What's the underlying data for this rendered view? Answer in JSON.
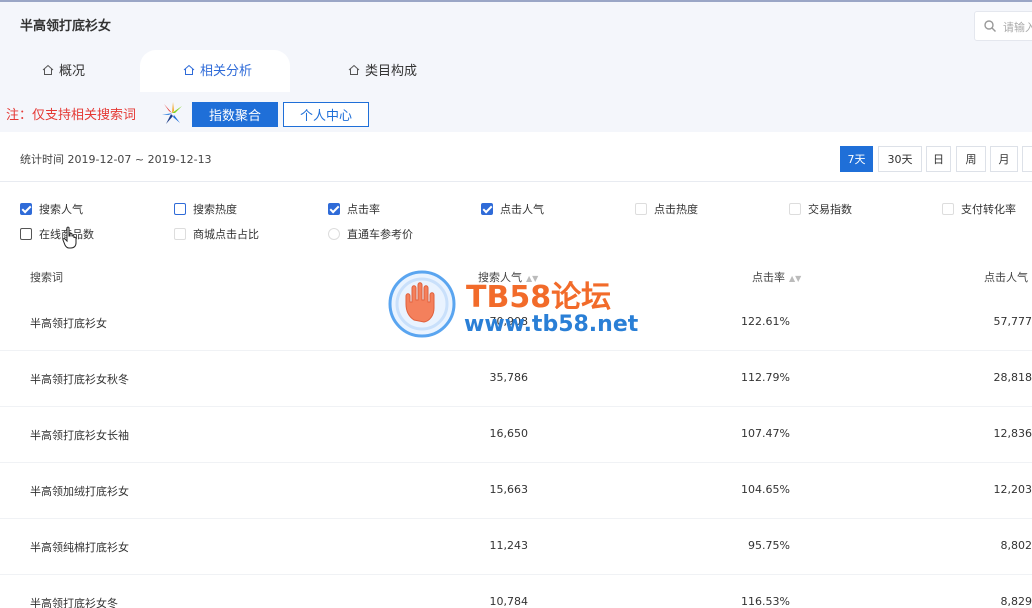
{
  "header": {
    "title": "半高领打底衫女",
    "search_placeholder": "请输入"
  },
  "tabs": [
    {
      "label": "概况",
      "active": false
    },
    {
      "label": "相关分析",
      "active": true
    },
    {
      "label": "类目构成",
      "active": false
    }
  ],
  "notice": "注：仅支持相关搜索词",
  "buttons": {
    "index_aggregate": "指数聚合",
    "personal_center": "个人中心"
  },
  "stat": {
    "text": "统计时间 2019-12-07 ~ 2019-12-13",
    "ranges": [
      "7天",
      "30天",
      "日",
      "周",
      "月"
    ],
    "active_range": "7天"
  },
  "metrics": [
    {
      "label": "搜索人气",
      "checked": true
    },
    {
      "label": "搜索热度",
      "checked": false
    },
    {
      "label": "点击率",
      "checked": true
    },
    {
      "label": "点击人气",
      "checked": true
    },
    {
      "label": "点击热度",
      "checked": false
    },
    {
      "label": "交易指数",
      "checked": false
    },
    {
      "label": "支付转化率",
      "checked": false
    },
    {
      "label": "在线商品数",
      "checked": false
    },
    {
      "label": "商城点击占比",
      "checked": false
    },
    {
      "label": "直通车参考价",
      "checked": false
    }
  ],
  "table": {
    "columns": [
      "搜索词",
      "搜索人气",
      "点击率",
      "点击人气"
    ],
    "rows": [
      {
        "keyword": "半高领打底衫女",
        "search_pop": "70,908",
        "ctr": "122.61%",
        "click_pop": "57,777"
      },
      {
        "keyword": "半高领打底衫女秋冬",
        "search_pop": "35,786",
        "ctr": "112.79%",
        "click_pop": "28,818"
      },
      {
        "keyword": "半高领打底衫女长袖",
        "search_pop": "16,650",
        "ctr": "107.47%",
        "click_pop": "12,836"
      },
      {
        "keyword": "半高领加绒打底衫女",
        "search_pop": "15,663",
        "ctr": "104.65%",
        "click_pop": "12,203"
      },
      {
        "keyword": "半高领纯棉打底衫女",
        "search_pop": "11,243",
        "ctr": "95.75%",
        "click_pop": "8,802"
      },
      {
        "keyword": "半高领打底衫女冬",
        "search_pop": "10,784",
        "ctr": "116.53%",
        "click_pop": "8,829"
      }
    ]
  },
  "watermark": {
    "title": "TB58论坛",
    "url": "www.tb58.net"
  },
  "colors": {
    "primary": "#1f6fd8",
    "notice": "#e53935",
    "watermark_title": "#f26b2a",
    "watermark_url": "#2a7fd6"
  }
}
